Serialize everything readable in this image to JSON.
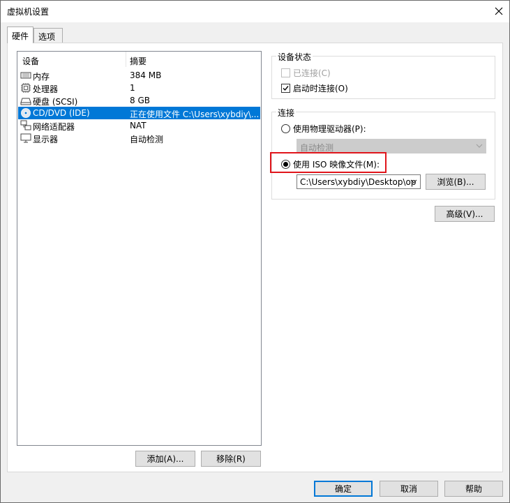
{
  "window": {
    "title": "虚拟机设置"
  },
  "tabs": [
    {
      "label": "硬件",
      "active": true
    },
    {
      "label": "选项",
      "active": false
    }
  ],
  "device_list": {
    "columns": [
      "设备",
      "摘要"
    ],
    "rows": [
      {
        "icon": "memory-icon",
        "name": "内存",
        "summary": "384 MB",
        "selected": false
      },
      {
        "icon": "processor-icon",
        "name": "处理器",
        "summary": "1",
        "selected": false
      },
      {
        "icon": "harddisk-icon",
        "name": "硬盘 (SCSI)",
        "summary": "8 GB",
        "selected": false
      },
      {
        "icon": "cd-dvd-icon",
        "name": "CD/DVD (IDE)",
        "summary": "正在使用文件 C:\\Users\\xybdiy\\...",
        "selected": true
      },
      {
        "icon": "network-adapter-icon",
        "name": "网络适配器",
        "summary": "NAT",
        "selected": false
      },
      {
        "icon": "display-icon",
        "name": "显示器",
        "summary": "自动检测",
        "selected": false
      }
    ]
  },
  "left_buttons": {
    "add": "添加(A)...",
    "remove": "移除(R)"
  },
  "device_status": {
    "title": "设备状态",
    "connected": {
      "label": "已连接(C)",
      "checked": false,
      "disabled": true
    },
    "connect_at_power_on": {
      "label": "启动时连接(O)",
      "checked": true
    }
  },
  "connection": {
    "title": "连接",
    "physical_drive": {
      "label": "使用物理驱动器(P):",
      "selected": false
    },
    "physical_drive_combo": {
      "value": "自动检测",
      "disabled": true
    },
    "iso_image": {
      "label": "使用 ISO 映像文件(M):",
      "selected": true
    },
    "iso_path": {
      "value": "C:\\Users\\xybdiy\\Desktop\\op"
    },
    "browse_label": "浏览(B)..."
  },
  "advanced_label": "高级(V)...",
  "footer": {
    "ok": "确定",
    "cancel": "取消",
    "help": "帮助"
  },
  "colors": {
    "selection": "#0078d7",
    "highlight_box": "#e0151b"
  }
}
